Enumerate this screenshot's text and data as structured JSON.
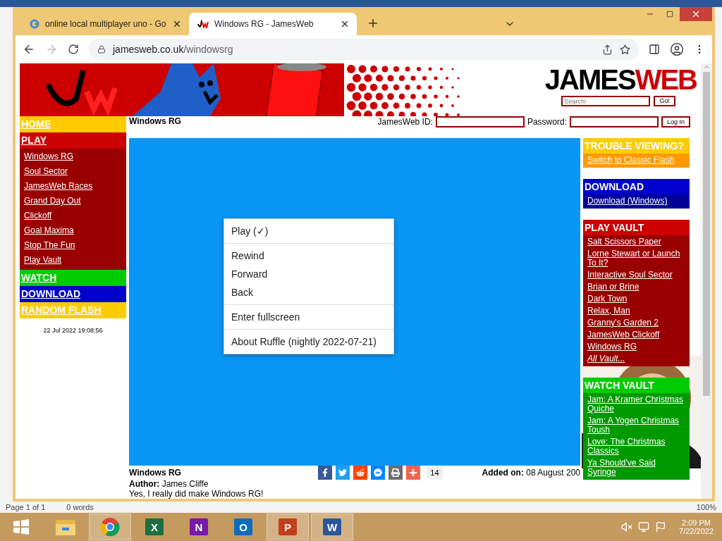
{
  "browser": {
    "tabs": [
      {
        "title": "online local multiplayer uno - Go",
        "kind": "google",
        "selected": false
      },
      {
        "title": "Windows RG - JamesWeb",
        "kind": "jw",
        "selected": true
      }
    ],
    "url": {
      "host": "jamesweb.co.uk",
      "path": "/windowsrg"
    }
  },
  "header": {
    "logo": [
      {
        "text": "JAMES",
        "color": "#000000"
      },
      {
        "text": "WEB",
        "color": "#cc0000"
      }
    ],
    "search": {
      "placeholder": "Search!",
      "button": "Go!"
    }
  },
  "nav": [
    {
      "label": "HOME",
      "color": "#ffcc00"
    },
    {
      "label": "PLAY",
      "color": "#cc0000",
      "children": [
        "Windows RG",
        "Soul Sector",
        "JamesWeb Races",
        "Grand Day Out",
        "Clickoff",
        "Goal Maxima",
        "Stop The Fun",
        "Play Vault"
      ]
    },
    {
      "label": "WATCH",
      "color": "#00cc00"
    },
    {
      "label": "DOWNLOAD",
      "color": "#0000cc"
    },
    {
      "label": "RANDOM FLASH",
      "color": "#ffcc00"
    }
  ],
  "timestamp": "22 Jul 2022 19:08:56",
  "page_title": "Windows RG",
  "login": {
    "id_label": "JamesWeb ID:",
    "password_label": "Password:",
    "button": "Log In"
  },
  "context_menu": [
    [
      "Play (✓)"
    ],
    [
      "Rewind",
      "Forward",
      "Back"
    ],
    [
      "Enter fullscreen"
    ],
    [
      "About Ruffle (nightly 2022-07-21)"
    ]
  ],
  "game_info": {
    "title": "Windows RG",
    "share": [
      {
        "kind": "facebook",
        "color": "#3b5998"
      },
      {
        "kind": "twitter",
        "color": "#1da1f2"
      },
      {
        "kind": "reddit",
        "color": "#ff4500"
      },
      {
        "kind": "messenger",
        "color": "#0084ff"
      },
      {
        "kind": "print",
        "color": "#6d6d6d"
      },
      {
        "kind": "more",
        "color": "#f2644f"
      }
    ],
    "share_count": "14",
    "added_label": "Added on:",
    "added_value": "08 August 200",
    "author_label": "Author:",
    "author_value": "James Cliffe",
    "description": "Yes, I really did make Windows RG!"
  },
  "right_boxes": [
    {
      "title": "TROUBLE VIEWING?",
      "color": "#ffcc00",
      "links": [
        {
          "label": "Switch to Classic Flash",
          "kind": "link"
        }
      ]
    },
    {
      "title": "DOWNLOAD",
      "color": "#0000cc",
      "links": [
        {
          "label": "Download (Windows)",
          "kind": "link"
        }
      ]
    },
    {
      "title": "PLAY VAULT",
      "color": "#cc0000",
      "links": [
        {
          "label": "Salt Scissors Paper",
          "kind": "link"
        },
        {
          "label": "Lorne Stewart or Launch To It?",
          "kind": "link"
        },
        {
          "label": "Interactive Soul Sector",
          "kind": "link"
        },
        {
          "label": "Brian or Brine",
          "kind": "link"
        },
        {
          "label": "Dark Town",
          "kind": "link"
        },
        {
          "label": "Relax, Man",
          "kind": "link"
        },
        {
          "label": "Granny's Garden 2",
          "kind": "link"
        },
        {
          "label": "JamesWeb Clickoff",
          "kind": "link"
        },
        {
          "label": "Windows RG",
          "kind": "link"
        },
        {
          "label": "All Vault...",
          "kind": "more"
        }
      ]
    },
    {
      "title": "WATCH VAULT",
      "color": "#00cc00",
      "links": [
        {
          "label": "Jam: A Kramer Christmas Quiche",
          "kind": "link"
        },
        {
          "label": "Jam: A Yogen Christmas Toush",
          "kind": "link"
        },
        {
          "label": "Love: The Christmas Classics",
          "kind": "link"
        },
        {
          "label": "Ya Should've Said Syringe",
          "kind": "link"
        }
      ]
    }
  ],
  "background_doc": {
    "status_left": [
      "Page 1 of 1",
      "0 words"
    ],
    "zoom": "100%"
  },
  "taskbar": {
    "apps": [
      {
        "kind": "explorer",
        "selected": false
      },
      {
        "kind": "chrome",
        "selected": true
      },
      {
        "kind": "office",
        "letter": "X",
        "color": "#1d6f42",
        "selected": false
      },
      {
        "kind": "office",
        "letter": "N",
        "color": "#7719aa",
        "selected": false
      },
      {
        "kind": "office",
        "letter": "O",
        "color": "#0f6cbd",
        "selected": false
      },
      {
        "kind": "office",
        "letter": "P",
        "color": "#c43e1c",
        "selected": true
      },
      {
        "kind": "office",
        "letter": "W",
        "color": "#2b579a",
        "selected": true
      }
    ],
    "time": "2:09 PM",
    "date": "7/22/2022"
  }
}
